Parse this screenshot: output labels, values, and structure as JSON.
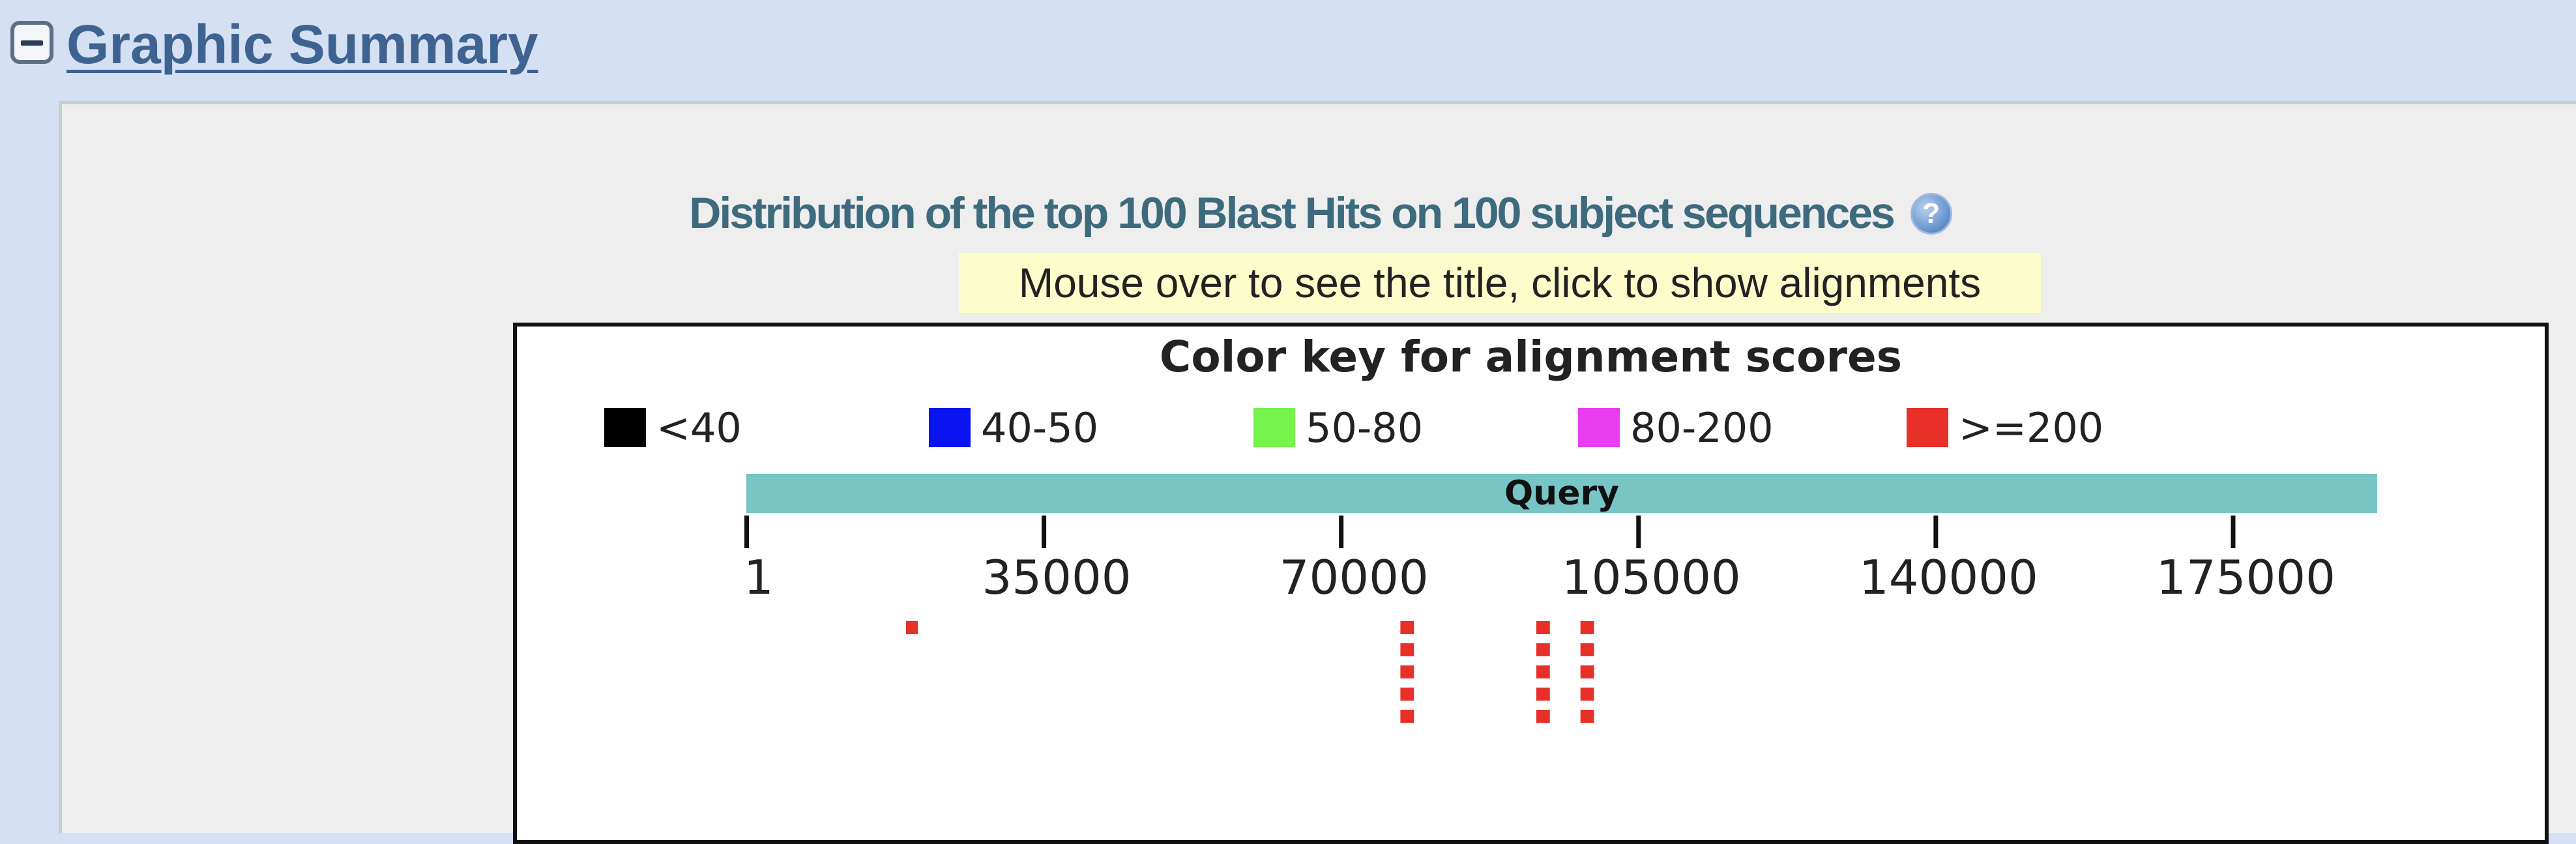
{
  "section": {
    "title": "Graphic Summary",
    "collapse_icon": "minus-box-icon"
  },
  "graphic": {
    "heading": "Distribution of the top 100 Blast Hits on 100 subject sequences",
    "help_icon": "question-mark-icon",
    "help_glyph": "?",
    "hint": "Mouse over to see the title, click to show alignments",
    "color_key_title": "Color key for alignment scores",
    "legend": [
      {
        "label": "<40",
        "color": "#000000"
      },
      {
        "label": "40-50",
        "color": "#0a14f0"
      },
      {
        "label": "50-80",
        "color": "#76f34c"
      },
      {
        "label": "80-200",
        "color": "#e93ef0"
      },
      {
        "label": ">=200",
        "color": "#e8302a"
      }
    ],
    "query_label": "Query",
    "query_color": "#78c5c6",
    "axis": {
      "min": 1,
      "max": 192000,
      "ticks": [
        {
          "value": 1,
          "label": "1"
        },
        {
          "value": 35000,
          "label": "35000"
        },
        {
          "value": 70000,
          "label": "70000"
        },
        {
          "value": 105000,
          "label": "105000"
        },
        {
          "value": 140000,
          "label": "140000"
        },
        {
          "value": 175000,
          "label": "175000"
        }
      ]
    },
    "hits": [
      {
        "start": 18800,
        "end": 20200,
        "rows": 1,
        "score_color": "#e8302a"
      },
      {
        "start": 77000,
        "end": 78600,
        "rows": 5,
        "score_color": "#e8302a"
      },
      {
        "start": 93000,
        "end": 94600,
        "rows": 5,
        "score_color": "#e8302a"
      },
      {
        "start": 98200,
        "end": 99800,
        "rows": 5,
        "score_color": "#e8302a"
      }
    ]
  }
}
